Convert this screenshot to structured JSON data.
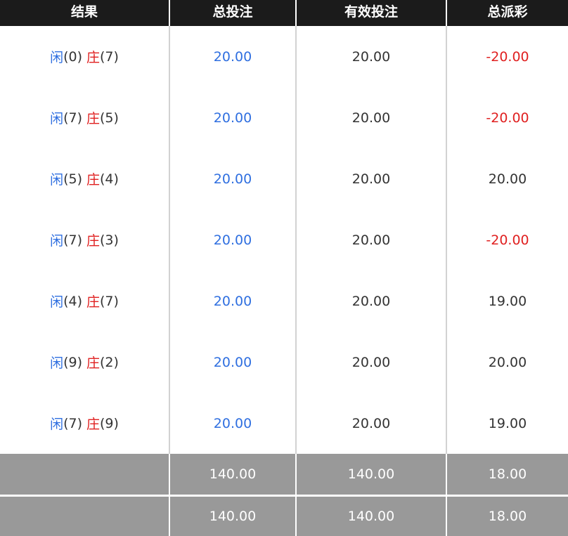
{
  "header": {
    "col_result": "结果",
    "col_total_bet": "总投注",
    "col_valid_bet": "有效投注",
    "col_total_payout": "总派彩"
  },
  "labels": {
    "player": "闲",
    "banker": "庄"
  },
  "rows": [
    {
      "player": "(0)",
      "banker": "(7)",
      "total_bet": "20.00",
      "valid_bet": "20.00",
      "payout": "-20.00",
      "payout_color": "#e02020"
    },
    {
      "player": "(7)",
      "banker": "(5)",
      "total_bet": "20.00",
      "valid_bet": "20.00",
      "payout": "-20.00",
      "payout_color": "#e02020"
    },
    {
      "player": "(5)",
      "banker": "(4)",
      "total_bet": "20.00",
      "valid_bet": "20.00",
      "payout": "20.00",
      "payout_color": "#333333"
    },
    {
      "player": "(7)",
      "banker": "(3)",
      "total_bet": "20.00",
      "valid_bet": "20.00",
      "payout": "-20.00",
      "payout_color": "#e02020"
    },
    {
      "player": "(4)",
      "banker": "(7)",
      "total_bet": "20.00",
      "valid_bet": "20.00",
      "payout": "19.00",
      "payout_color": "#333333"
    },
    {
      "player": "(9)",
      "banker": "(2)",
      "total_bet": "20.00",
      "valid_bet": "20.00",
      "payout": "20.00",
      "payout_color": "#333333"
    },
    {
      "player": "(7)",
      "banker": "(9)",
      "total_bet": "20.00",
      "valid_bet": "20.00",
      "payout": "19.00",
      "payout_color": "#333333"
    }
  ],
  "subtotal": {
    "label": "",
    "total_bet": "140.00",
    "valid_bet": "140.00",
    "payout": "18.00"
  },
  "total": {
    "label": "",
    "total_bet": "140.00",
    "valid_bet": "140.00",
    "payout": "18.00"
  },
  "colors": {
    "header_bg": "#1b1b1b",
    "summary_bg": "#999999",
    "player_blue": "#2f6fe0",
    "banker_red": "#e02020",
    "negative_red": "#e02020"
  }
}
